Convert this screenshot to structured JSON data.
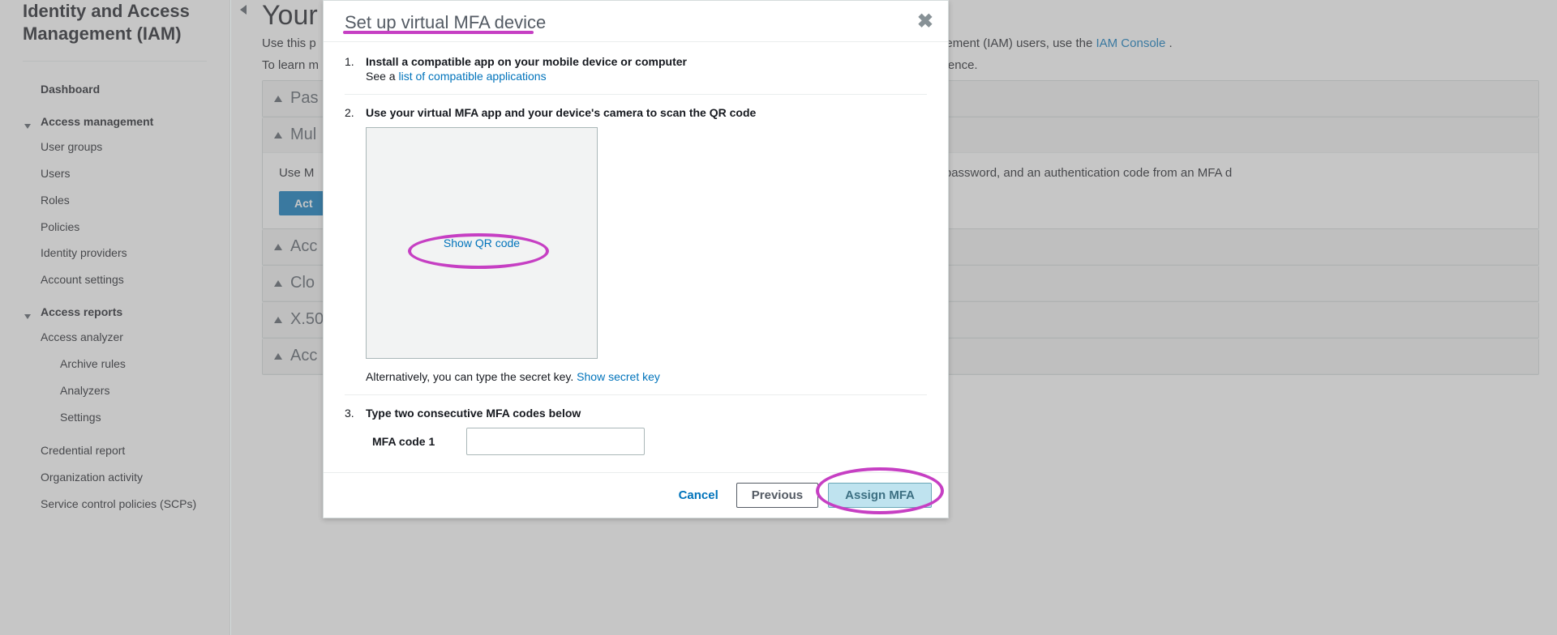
{
  "brand": "Identity and Access Management (IAM)",
  "sidebar": {
    "dashboard": "Dashboard",
    "access_mgmt": "Access management",
    "items": [
      "User groups",
      "Users",
      "Roles",
      "Policies",
      "Identity providers",
      "Account settings"
    ],
    "reports": "Access reports",
    "analyzer": "Access analyzer",
    "analyzer_children": [
      "Archive rules",
      "Analyzers",
      "Settings"
    ],
    "report_items": [
      "Credential report",
      "Organization activity",
      "Service control policies (SCPs)"
    ]
  },
  "page": {
    "title": "Your",
    "intro_prefix": "Use this p",
    "intro_suffix": "gement (IAM) users, use the ",
    "intro_link": "IAM Console",
    "intro_dot": " .",
    "learn_prefix": "To learn m",
    "learn_suffix": "ference."
  },
  "panels": {
    "p1": "Pas",
    "p2": "Mul",
    "p2_body_a": "Use M",
    "p2_body_b": "me, password, and an authentication code from an MFA d",
    "p2_button": "Act",
    "p3": "Acc",
    "p4": "Clo",
    "p5": "X.50",
    "p6": "Acc"
  },
  "modal": {
    "title": "Set up virtual MFA device",
    "step1_title": "Install a compatible app on your mobile device or computer",
    "step1_see": "See a ",
    "step1_link": "list of compatible applications",
    "step2_title": "Use your virtual MFA app and your device's camera to scan the QR code",
    "show_qr": "Show QR code",
    "alternative": "Alternatively, you can type the secret key. ",
    "show_secret": "Show secret key",
    "step3_title": "Type two consecutive MFA codes below",
    "code1_label": "MFA code 1",
    "cancel": "Cancel",
    "previous": "Previous",
    "assign": "Assign MFA"
  }
}
